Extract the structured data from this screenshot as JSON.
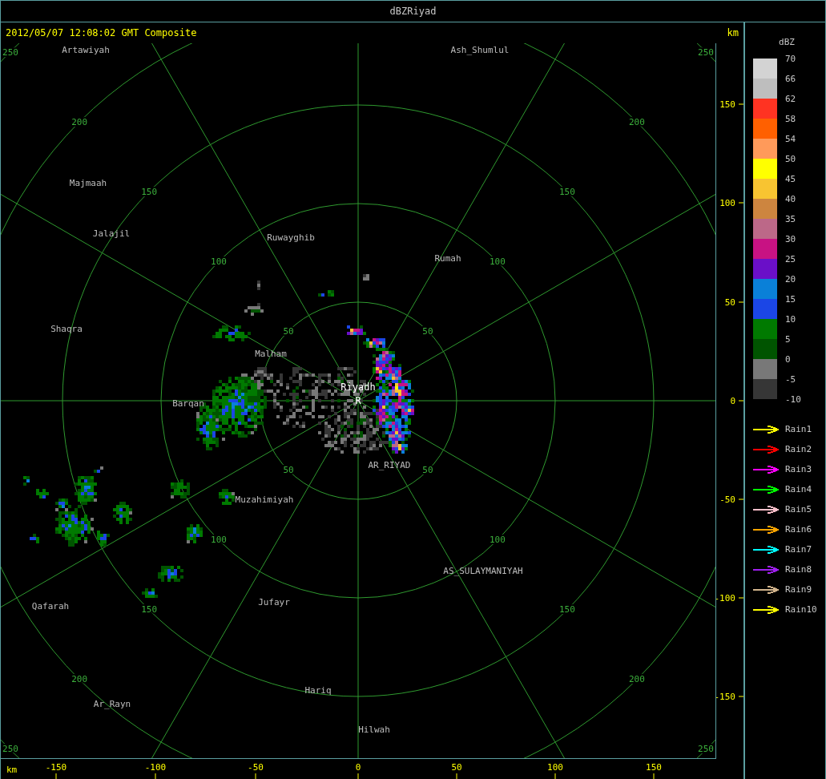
{
  "window": {
    "title": "dBZRiyad"
  },
  "header": {
    "timestamp": "2012/05/07 12:08:02 GMT Composite",
    "unit": "km"
  },
  "map": {
    "range_rings": [
      {
        "labels": [
          "50",
          "50",
          "50",
          "50"
        ]
      },
      {
        "labels": [
          "100",
          "100",
          "100",
          "100"
        ]
      },
      {
        "labels": [
          "150",
          "150",
          "150",
          "150"
        ]
      },
      {
        "labels": [
          "200",
          "200",
          "200",
          "200"
        ]
      },
      {
        "labels": [
          "250",
          "250",
          "250",
          "250"
        ]
      }
    ],
    "places": [
      {
        "name": "Artawiyah",
        "kind": "city"
      },
      {
        "name": "Ash_Shumlul",
        "kind": "city"
      },
      {
        "name": "Majmaah",
        "kind": "city"
      },
      {
        "name": "Jalajil",
        "kind": "city"
      },
      {
        "name": "Ruwayghib",
        "kind": "city"
      },
      {
        "name": "Rumah",
        "kind": "city"
      },
      {
        "name": "Shaqra",
        "kind": "city"
      },
      {
        "name": "Malham",
        "kind": "city"
      },
      {
        "name": "Riyadh",
        "kind": "radar"
      },
      {
        "name": "R",
        "kind": "radar"
      },
      {
        "name": "Barqan",
        "kind": "city"
      },
      {
        "name": "AR_RIYAD",
        "kind": "city"
      },
      {
        "name": "Muzahimiyah",
        "kind": "city"
      },
      {
        "name": "AS_SULAYMANIYAH",
        "kind": "city"
      },
      {
        "name": "Qafarah",
        "kind": "city"
      },
      {
        "name": "Jufayr",
        "kind": "city"
      },
      {
        "name": "Hariq",
        "kind": "city"
      },
      {
        "name": "Ar_Rayn",
        "kind": "city"
      },
      {
        "name": "Hilwah",
        "kind": "city"
      }
    ]
  },
  "y_axis": {
    "ticks": [
      "150",
      "100",
      "50",
      "0",
      "-50",
      "-100",
      "-150"
    ]
  },
  "x_axis": {
    "unit": "km",
    "ticks": [
      "-150",
      "-100",
      "-50",
      "0",
      "50",
      "100",
      "150"
    ]
  },
  "legend": {
    "title": "dBZ",
    "bins": [
      {
        "color": "#d3d3d3"
      },
      {
        "color": "#bebebe"
      },
      {
        "color": "#ff3322"
      },
      {
        "color": "#ff6000"
      },
      {
        "color": "#ff9a5a"
      },
      {
        "color": "#ffff00"
      },
      {
        "color": "#f8c431"
      },
      {
        "color": "#cd853f"
      },
      {
        "color": "#bc6888"
      },
      {
        "color": "#c81283"
      },
      {
        "color": "#6a0fc8"
      },
      {
        "color": "#0a80d8"
      },
      {
        "color": "#1b46e6"
      },
      {
        "color": "#007a00"
      },
      {
        "color": "#005400"
      },
      {
        "color": "#787878"
      },
      {
        "color": "#363636"
      }
    ],
    "labels": [
      "70",
      "66",
      "62",
      "58",
      "54",
      "50",
      "45",
      "40",
      "35",
      "30",
      "25",
      "20",
      "15",
      "10",
      "5",
      "0",
      "-5",
      "-10"
    ]
  },
  "tracks": [
    {
      "label": "Rain1",
      "color": "#ffff00"
    },
    {
      "label": "Rain2",
      "color": "#ff0000"
    },
    {
      "label": "Rain3",
      "color": "#ff00ff"
    },
    {
      "label": "Rain4",
      "color": "#00ff00"
    },
    {
      "label": "Rain5",
      "color": "#ffc0cb"
    },
    {
      "label": "Rain6",
      "color": "#ffa500"
    },
    {
      "label": "Rain7",
      "color": "#00ffff"
    },
    {
      "label": "Rain8",
      "color": "#a020f0"
    },
    {
      "label": "Rain9",
      "color": "#d2b48c"
    },
    {
      "label": "Rain10",
      "color": "#ffff00"
    }
  ]
}
